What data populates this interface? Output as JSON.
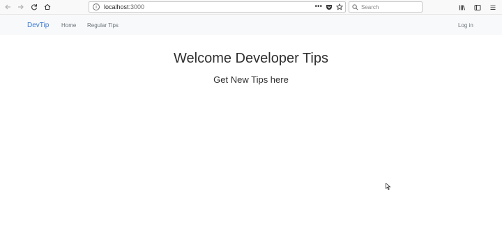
{
  "browser": {
    "url_host": "localhost",
    "url_port": ":3000",
    "search_placeholder": "Search",
    "icons": {
      "back": "arrow-left-icon",
      "forward": "arrow-right-icon",
      "reload": "reload-icon",
      "home": "home-icon",
      "site_info": "info-icon",
      "page_actions": "more-icon",
      "pocket": "pocket-icon",
      "bookmark": "star-icon",
      "search": "search-icon",
      "library": "library-icon",
      "sidebar": "sidebar-icon",
      "menu": "hamburger-menu-icon"
    }
  },
  "navbar": {
    "brand": "DevTip",
    "links": [
      "Home",
      "Regular Tips"
    ],
    "login": "Log in",
    "brand_color": "#3a7bd5"
  },
  "main": {
    "title": "Welcome Developer Tips",
    "subtitle": "Get New Tips here"
  }
}
